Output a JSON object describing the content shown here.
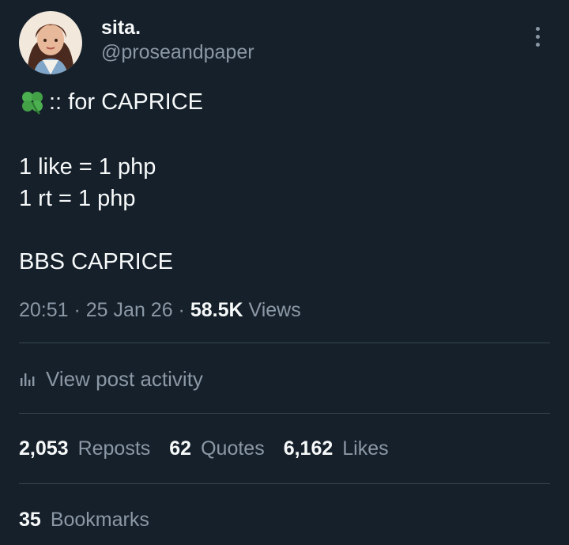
{
  "author": {
    "display_name": "sita.",
    "handle": "@proseandpaper",
    "avatar_icon": "avatar-illustration"
  },
  "tweet": {
    "line1_icon": "four-leaf-clover-icon",
    "line1_text": ":: for CAPRICE",
    "line2": "1 like = 1 php",
    "line3": "1 rt = 1 php",
    "line4": "BBS CAPRICE"
  },
  "meta": {
    "time": "20:51",
    "separator": " · ",
    "date": "25 Jan 26",
    "views_count": "58.5K",
    "views_label": "Views"
  },
  "activity": {
    "icon": "bar-chart-icon",
    "label": "View post activity"
  },
  "stats": {
    "reposts_count": "2,053",
    "reposts_label": "Reposts",
    "quotes_count": "62",
    "quotes_label": "Quotes",
    "likes_count": "6,162",
    "likes_label": "Likes"
  },
  "bookmarks": {
    "count": "35",
    "label": "Bookmarks"
  },
  "colors": {
    "background": "#15202b",
    "primary_text": "#f7f9f9",
    "secondary_text": "#8b98a5",
    "divider": "#38444d"
  }
}
